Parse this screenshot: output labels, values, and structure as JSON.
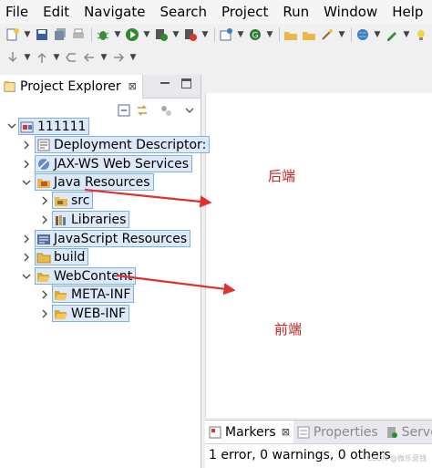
{
  "menu": [
    "File",
    "Edit",
    "Navigate",
    "Search",
    "Project",
    "Run",
    "Window",
    "Help"
  ],
  "explorer": {
    "title": "Project Explorer",
    "close_glyph": "⊠"
  },
  "tree": [
    {
      "label": "111111",
      "icon": "project-icon",
      "expanded": true
    },
    {
      "label": "Deployment Descriptor:",
      "icon": "deployment-descriptor-icon",
      "expanded": false
    },
    {
      "label": "JAX-WS Web Services",
      "icon": "web-services-icon",
      "expanded": false
    },
    {
      "label": "Java Resources",
      "icon": "java-resources-icon",
      "expanded": true
    },
    {
      "label": "src",
      "icon": "source-folder-icon",
      "expanded": false
    },
    {
      "label": "Libraries",
      "icon": "libraries-icon",
      "expanded": false
    },
    {
      "label": "JavaScript Resources",
      "icon": "javascript-resources-icon",
      "expanded": false
    },
    {
      "label": "build",
      "icon": "folder-icon",
      "expanded": false
    },
    {
      "label": "WebContent",
      "icon": "folder-open-icon",
      "expanded": true
    },
    {
      "label": "META-INF",
      "icon": "folder-icon",
      "expanded": false
    },
    {
      "label": "WEB-INF",
      "icon": "folder-icon",
      "expanded": false
    }
  ],
  "annotations": {
    "backend": "后端",
    "frontend": "前端",
    "arrow_color": "#e0322c"
  },
  "bottom_panel": {
    "tabs": [
      "Markers",
      "Properties",
      "Serve"
    ],
    "status": "1 error, 0 warnings, 0 others",
    "watermark": "CSDN @微乐意钱"
  },
  "colors": {
    "selection_bg": "#dbe9f8",
    "selection_border": "#7fb0df",
    "annotation_text": "#c8231e"
  }
}
